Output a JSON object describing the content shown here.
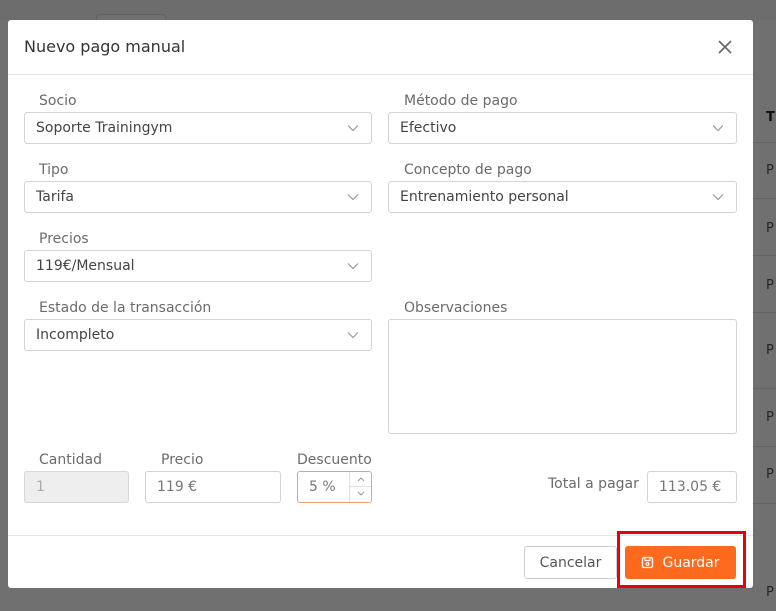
{
  "modal": {
    "title": "Nuevo pago manual"
  },
  "fields": {
    "socio": {
      "label": "Socio",
      "value": "Soporte Trainingym"
    },
    "metodo_pago": {
      "label": "Método de pago",
      "value": "Efectivo"
    },
    "tipo": {
      "label": "Tipo",
      "value": "Tarifa"
    },
    "concepto_pago": {
      "label": "Concepto de pago",
      "value": "Entrenamiento personal"
    },
    "precios": {
      "label": "Precios",
      "value": "119€/Mensual"
    },
    "estado": {
      "label": "Estado de la transacción",
      "value": "Incompleto"
    },
    "observaciones": {
      "label": "Observaciones",
      "value": ""
    },
    "cantidad": {
      "label": "Cantidad",
      "value": "1"
    },
    "precio": {
      "label": "Precio",
      "value": "119 €"
    },
    "descuento": {
      "label": "Descuento",
      "value": "5 %"
    },
    "total": {
      "label": "Total a pagar",
      "value": "113.05 €"
    }
  },
  "footer": {
    "cancel_label": "Cancelar",
    "save_label": "Guardar"
  },
  "background": {
    "column_header": "T",
    "row_initials": [
      "P",
      "P",
      "P",
      "P",
      "P",
      "P",
      "P"
    ]
  },
  "icons": {
    "close": "close-icon",
    "chevron": "chevron-down-icon",
    "save": "save-icon"
  },
  "colors": {
    "accent": "#fd6a1d",
    "highlight": "#e8000b"
  }
}
